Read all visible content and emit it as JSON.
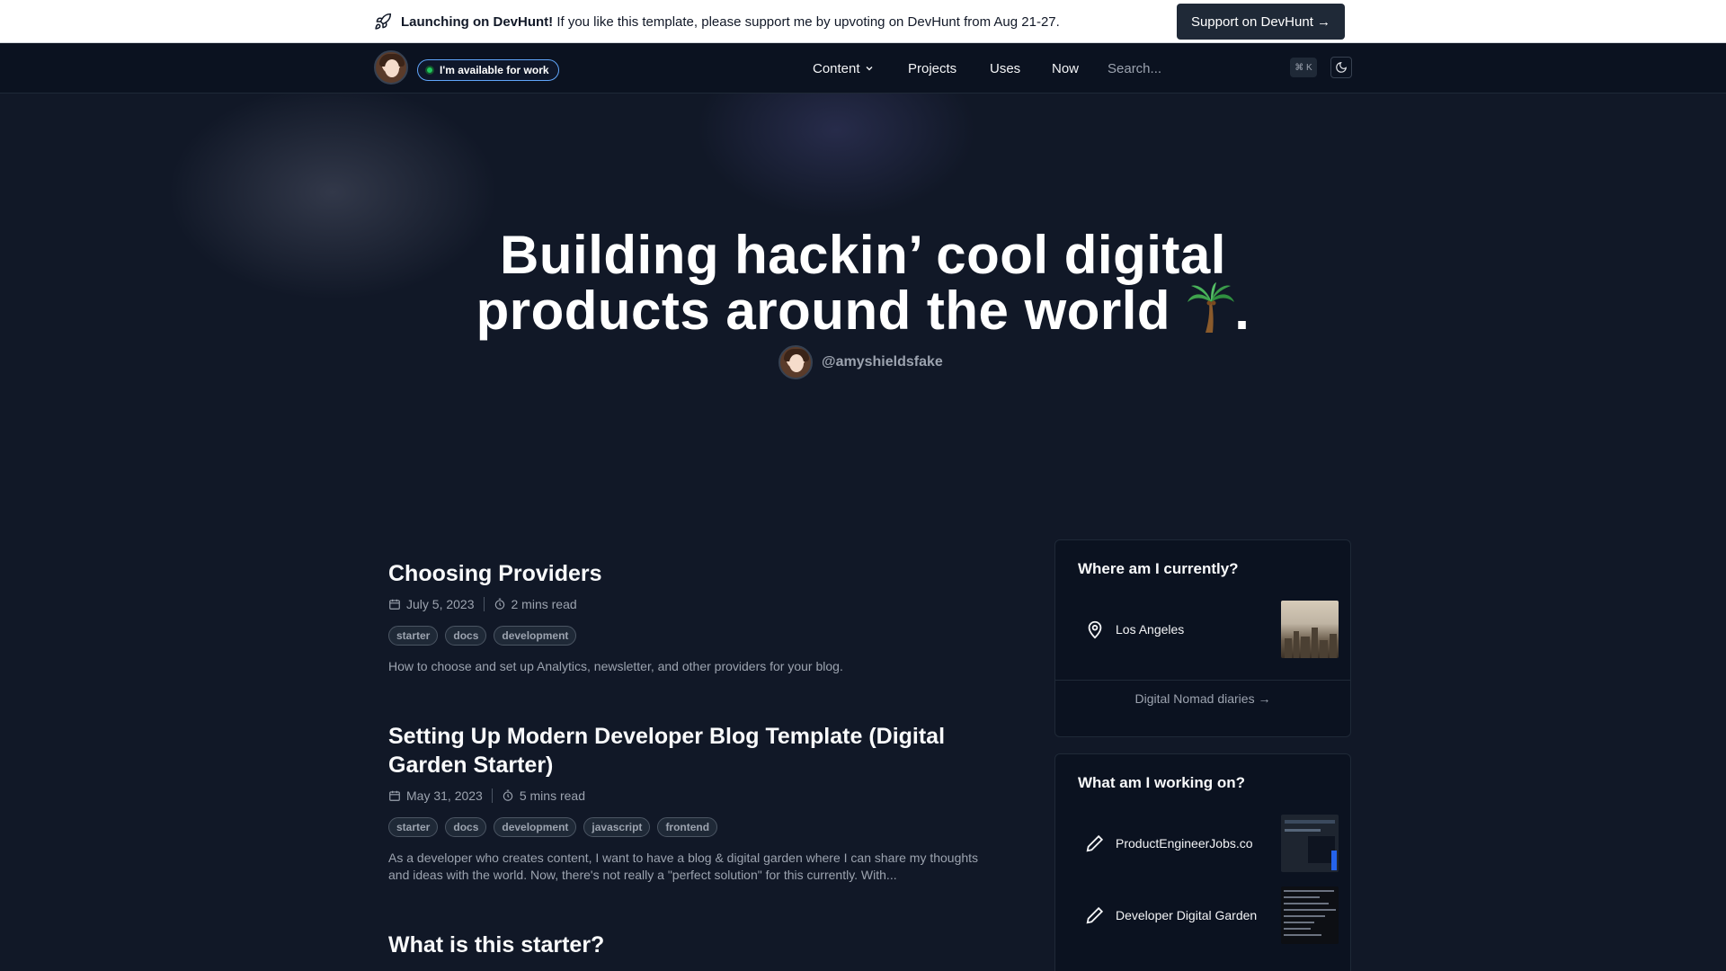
{
  "banner": {
    "title_bold": "Launching on DevHunt!",
    "message": " If you like this template, please support me by upvoting on DevHunt from Aug 21-27.",
    "button_label": "Support on DevHunt →",
    "icon": "rocket-icon"
  },
  "nav": {
    "available_label": "I'm available for work",
    "links": [
      {
        "label": "Content",
        "has_dropdown": true
      },
      {
        "label": "Projects"
      },
      {
        "label": "Uses"
      },
      {
        "label": "Now"
      }
    ],
    "search_placeholder": "Search...",
    "search_shortcut": "⌘ K",
    "theme_icon": "moon-icon"
  },
  "hero": {
    "title_line1": "Building hackin’ cool digital",
    "title_line2": "products around the world ",
    "title_end": ".",
    "emoji": "palm-tree-icon",
    "author_handle": "@amyshieldsfake"
  },
  "posts": [
    {
      "title": "Choosing Providers",
      "date": "July 5, 2023",
      "read_time": "2 mins read",
      "tags": [
        "starter",
        "docs",
        "development"
      ],
      "description": "How to choose and set up Analytics, newsletter, and other providers for your blog."
    },
    {
      "title": "Setting Up Modern Developer Blog Template (Digital Garden Starter)",
      "date": "May 31, 2023",
      "read_time": "5 mins read",
      "tags": [
        "starter",
        "docs",
        "development",
        "javascript",
        "frontend"
      ],
      "description": "As a developer who creates content, I want to have a blog & digital garden where I can share my thoughts and ideas with the world. Now, there's not really a \"perfect solution\" for this currently. With..."
    },
    {
      "title": "What is this starter?"
    }
  ],
  "sidebar": {
    "location_card": {
      "title": "Where am I currently?",
      "location": "Los Angeles",
      "link_label": "Digital Nomad diaries →"
    },
    "working_card": {
      "title": "What am I working on?",
      "items": [
        {
          "label": "ProductEngineerJobs.co"
        },
        {
          "label": "Developer Digital Garden"
        }
      ]
    }
  },
  "colors": {
    "background": "#111827",
    "nav_background": "#0b1220",
    "available_dot": "#22c55e",
    "available_border": "#60a5fa"
  }
}
